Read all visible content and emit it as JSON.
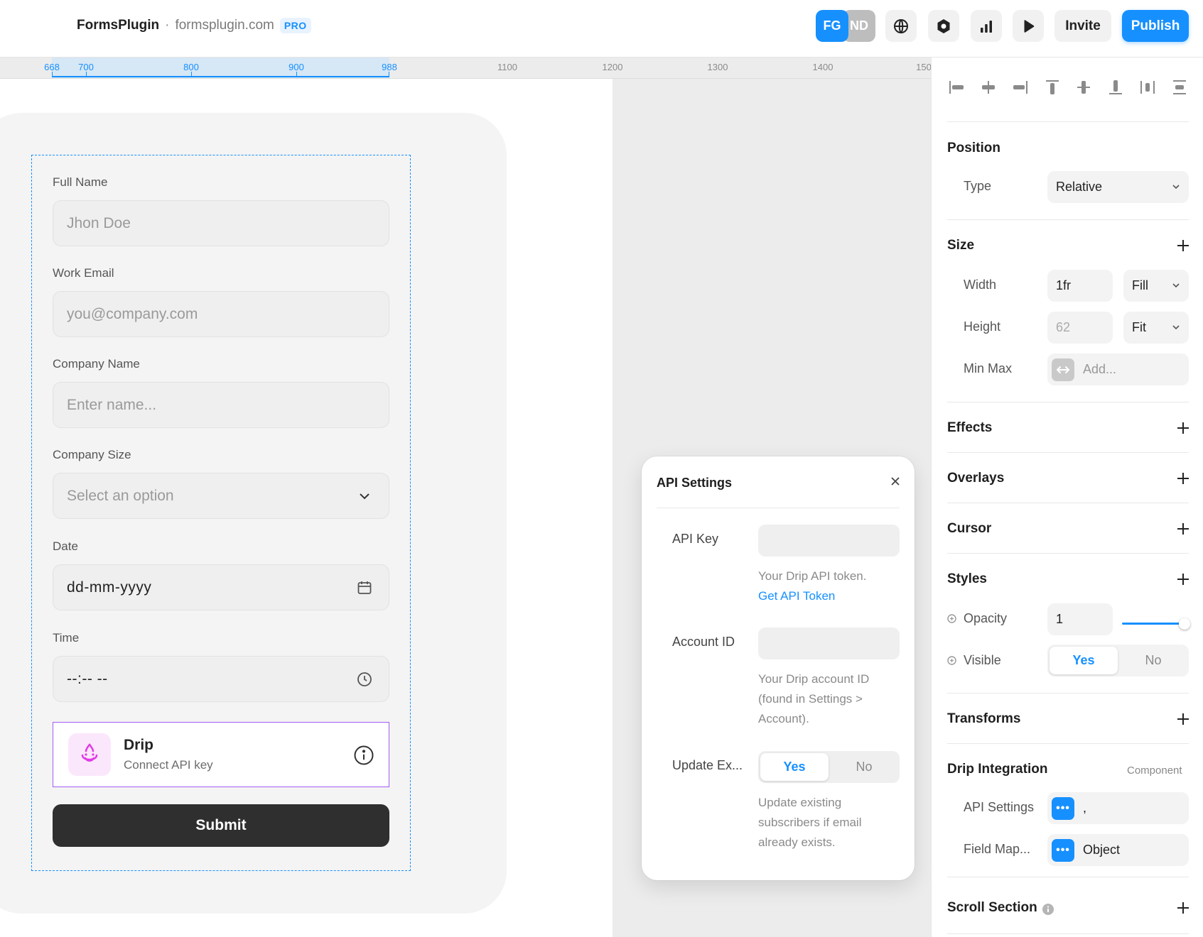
{
  "header": {
    "app_name": "FormsPlugin",
    "separator": "·",
    "domain": "formsplugin.com",
    "badge": "PRO",
    "avatars": [
      "FG",
      "ND"
    ],
    "invite_label": "Invite",
    "publish_label": "Publish"
  },
  "ruler": {
    "ticks": [
      "668",
      "700",
      "800",
      "900",
      "988",
      "1100",
      "1200",
      "1300",
      "1400",
      "150"
    ]
  },
  "form": {
    "fields": [
      {
        "label": "Full Name",
        "placeholder": "Jhon Doe"
      },
      {
        "label": "Work Email",
        "placeholder": "you@company.com"
      },
      {
        "label": "Company Name",
        "placeholder": "Enter name..."
      },
      {
        "label": "Company Size",
        "placeholder": "Select an option"
      },
      {
        "label": "Date",
        "value": "dd-mm-yyyy"
      },
      {
        "label": "Time",
        "value": "--:-- --"
      }
    ],
    "integration": {
      "title": "Drip",
      "subtitle": "Connect API key"
    },
    "submit_label": "Submit"
  },
  "api_popover": {
    "title": "API Settings",
    "api_key_label": "API Key",
    "api_key_value": "",
    "api_key_help": "Your Drip API token.",
    "api_key_link": "Get API Token",
    "account_id_label": "Account ID",
    "account_id_value": "",
    "account_id_help": "Your Drip account ID (found in Settings > Account).",
    "update_label": "Update Ex...",
    "update_yes": "Yes",
    "update_no": "No",
    "update_help": "Update existing subscribers if email already exists."
  },
  "panel": {
    "position": {
      "title": "Position",
      "type_label": "Type",
      "type_value": "Relative"
    },
    "size": {
      "title": "Size",
      "width_label": "Width",
      "width_value": "1fr",
      "width_mode": "Fill",
      "height_label": "Height",
      "height_value": "62",
      "height_mode": "Fit",
      "minmax_label": "Min Max",
      "minmax_placeholder": "Add..."
    },
    "effects": "Effects",
    "overlays": "Overlays",
    "cursor": "Cursor",
    "styles": {
      "title": "Styles",
      "opacity_label": "Opacity",
      "opacity_value": "1",
      "opacity_level": 1,
      "visible_label": "Visible",
      "visible_yes": "Yes",
      "visible_no": "No"
    },
    "transforms": "Transforms",
    "drip_integration": {
      "title": "Drip Integration",
      "tag": "Component",
      "api_settings_label": "API Settings",
      "api_settings_value": ",",
      "field_map_label": "Field Map...",
      "field_map_value": "Object",
      "dots": "•••"
    },
    "scroll_section": "Scroll Section"
  },
  "colors": {
    "accent": "#1690ff",
    "integration_border": "#a25cf0",
    "drip_pink": "#e13ce6",
    "submit_bg": "#2f2f2f"
  }
}
